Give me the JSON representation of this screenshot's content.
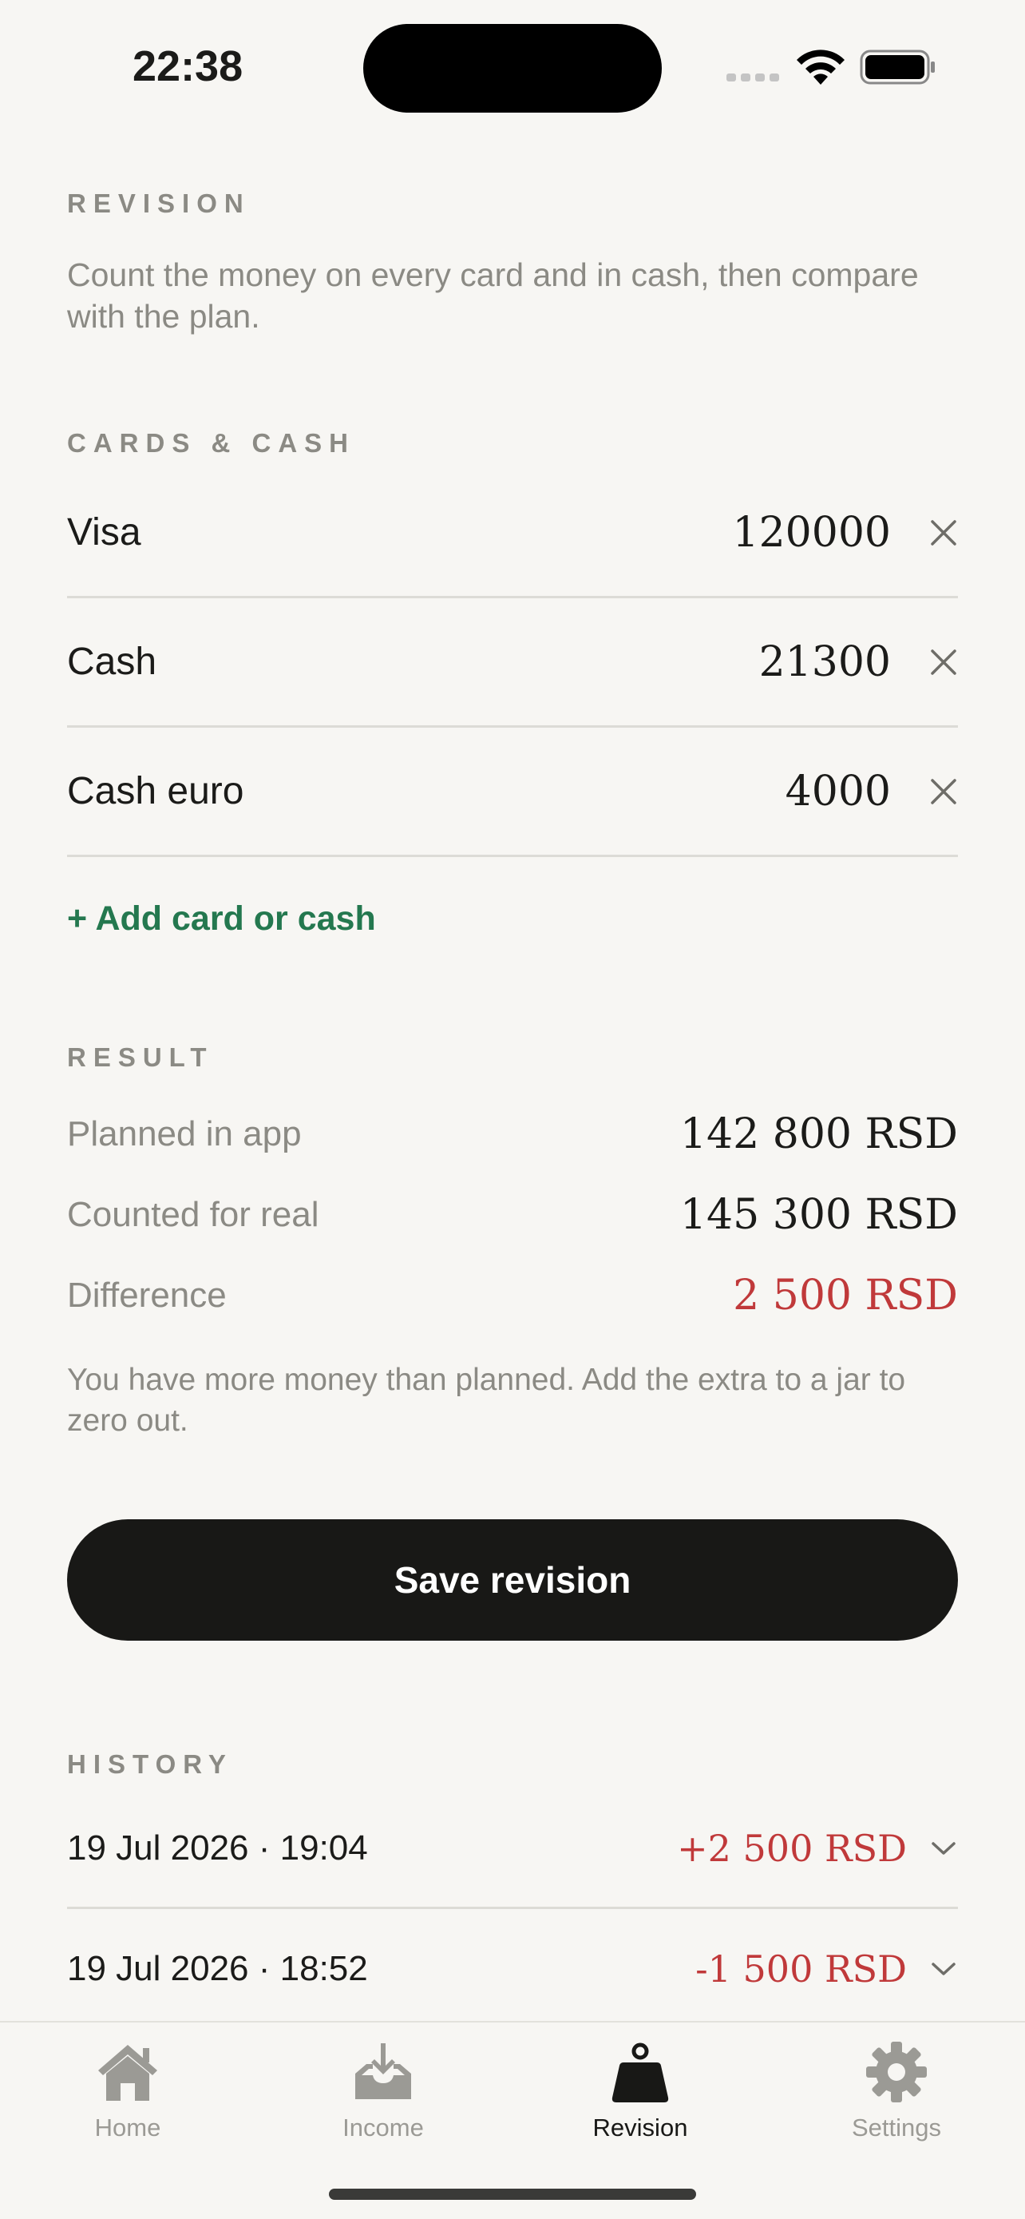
{
  "status": {
    "time": "22:38"
  },
  "revision": {
    "title": "REVISION",
    "description": "Count the money on every card and in cash, then compare with the plan."
  },
  "accounts": {
    "title": "CARDS & CASH",
    "items": [
      {
        "name": "Visa",
        "amount": "120000"
      },
      {
        "name": "Cash",
        "amount": "21300"
      },
      {
        "name": "Cash euro",
        "amount": "4000"
      }
    ],
    "add_label": "+ Add card or cash"
  },
  "result": {
    "title": "RESULT",
    "planned_label": "Planned in app",
    "planned_value": "142 800 RSD",
    "counted_label": "Counted for real",
    "counted_value": "145 300 RSD",
    "difference_label": "Difference",
    "difference_value": "2 500 RSD",
    "note": "You have more money than planned. Add the extra to a jar to zero out."
  },
  "save_label": "Save revision",
  "history": {
    "title": "HISTORY",
    "items": [
      {
        "date": "19 Jul 2026 · 19:04",
        "delta": "+2 500 RSD"
      },
      {
        "date": "19 Jul 2026 · 18:52",
        "delta": "-1 500 RSD"
      }
    ]
  },
  "tabs": [
    {
      "label": "Home",
      "icon": "house-icon"
    },
    {
      "label": "Income",
      "icon": "inbox-download-icon"
    },
    {
      "label": "Revision",
      "icon": "weight-icon",
      "active": true
    },
    {
      "label": "Settings",
      "icon": "gear-icon"
    }
  ],
  "colors": {
    "background": "#f7f6f3",
    "accent_green": "#24784f",
    "negative_red": "#c0393a",
    "button_dark": "#181816"
  }
}
